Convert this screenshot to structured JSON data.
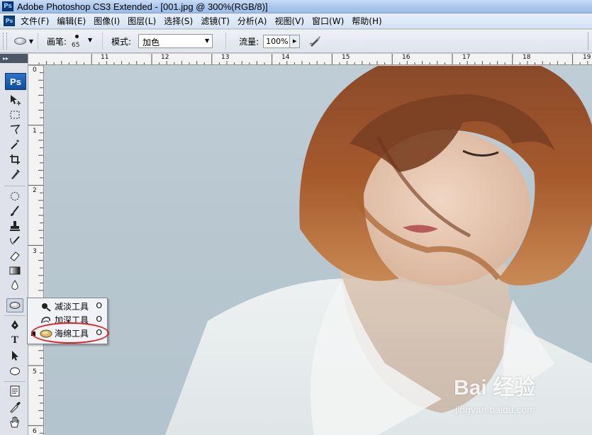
{
  "window": {
    "title": "Adobe Photoshop CS3 Extended - [001.jpg @ 300%(RGB/8)]",
    "app_icon": "Ps"
  },
  "menu": [
    "文件(F)",
    "编辑(E)",
    "图像(I)",
    "图层(L)",
    "选择(S)",
    "滤镜(T)",
    "分析(A)",
    "视图(V)",
    "窗口(W)",
    "帮助(H)"
  ],
  "options": {
    "brush_label": "画笔:",
    "brush_size": "65",
    "mode_label": "模式:",
    "mode_value": "加色",
    "flow_label": "流量:",
    "flow_value": "100%"
  },
  "toolbox": {
    "logo": "Ps",
    "type_tool": "T"
  },
  "rulers": {
    "top": [
      "11",
      "12",
      "13",
      "14",
      "15",
      "16",
      "17",
      "18",
      "19"
    ],
    "left": [
      "0",
      "1",
      "2",
      "3",
      "4",
      "5",
      "6"
    ]
  },
  "flyout": {
    "items": [
      {
        "label": "减淡工具",
        "key": "O",
        "selected": false,
        "icon": "dodge-icon"
      },
      {
        "label": "加深工具",
        "key": "O",
        "selected": false,
        "icon": "burn-icon"
      },
      {
        "label": "海绵工具",
        "key": "O",
        "selected": true,
        "icon": "sponge-icon"
      }
    ]
  },
  "watermark": {
    "main": "Bai 经验",
    "url": "jingyan.baidu.com"
  },
  "colors": {
    "highlight": "#d8232a",
    "title_bar": "#a9c6ec"
  }
}
